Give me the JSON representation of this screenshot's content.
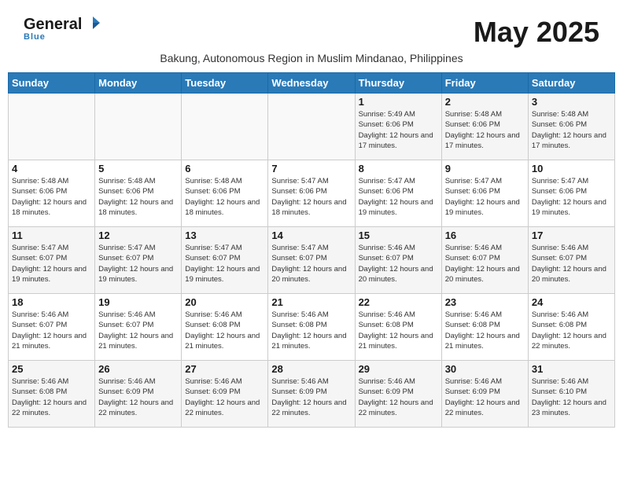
{
  "header": {
    "logo_general": "General",
    "logo_blue": "Blue",
    "month_title": "May 2025",
    "subtitle": "Bakung, Autonomous Region in Muslim Mindanao, Philippines"
  },
  "calendar": {
    "days_of_week": [
      "Sunday",
      "Monday",
      "Tuesday",
      "Wednesday",
      "Thursday",
      "Friday",
      "Saturday"
    ],
    "weeks": [
      [
        {
          "day": "",
          "info": ""
        },
        {
          "day": "",
          "info": ""
        },
        {
          "day": "",
          "info": ""
        },
        {
          "day": "",
          "info": ""
        },
        {
          "day": "1",
          "info": "Sunrise: 5:49 AM\nSunset: 6:06 PM\nDaylight: 12 hours and 17 minutes."
        },
        {
          "day": "2",
          "info": "Sunrise: 5:48 AM\nSunset: 6:06 PM\nDaylight: 12 hours and 17 minutes."
        },
        {
          "day": "3",
          "info": "Sunrise: 5:48 AM\nSunset: 6:06 PM\nDaylight: 12 hours and 17 minutes."
        }
      ],
      [
        {
          "day": "4",
          "info": "Sunrise: 5:48 AM\nSunset: 6:06 PM\nDaylight: 12 hours and 18 minutes."
        },
        {
          "day": "5",
          "info": "Sunrise: 5:48 AM\nSunset: 6:06 PM\nDaylight: 12 hours and 18 minutes."
        },
        {
          "day": "6",
          "info": "Sunrise: 5:48 AM\nSunset: 6:06 PM\nDaylight: 12 hours and 18 minutes."
        },
        {
          "day": "7",
          "info": "Sunrise: 5:47 AM\nSunset: 6:06 PM\nDaylight: 12 hours and 18 minutes."
        },
        {
          "day": "8",
          "info": "Sunrise: 5:47 AM\nSunset: 6:06 PM\nDaylight: 12 hours and 19 minutes."
        },
        {
          "day": "9",
          "info": "Sunrise: 5:47 AM\nSunset: 6:06 PM\nDaylight: 12 hours and 19 minutes."
        },
        {
          "day": "10",
          "info": "Sunrise: 5:47 AM\nSunset: 6:06 PM\nDaylight: 12 hours and 19 minutes."
        }
      ],
      [
        {
          "day": "11",
          "info": "Sunrise: 5:47 AM\nSunset: 6:07 PM\nDaylight: 12 hours and 19 minutes."
        },
        {
          "day": "12",
          "info": "Sunrise: 5:47 AM\nSunset: 6:07 PM\nDaylight: 12 hours and 19 minutes."
        },
        {
          "day": "13",
          "info": "Sunrise: 5:47 AM\nSunset: 6:07 PM\nDaylight: 12 hours and 19 minutes."
        },
        {
          "day": "14",
          "info": "Sunrise: 5:47 AM\nSunset: 6:07 PM\nDaylight: 12 hours and 20 minutes."
        },
        {
          "day": "15",
          "info": "Sunrise: 5:46 AM\nSunset: 6:07 PM\nDaylight: 12 hours and 20 minutes."
        },
        {
          "day": "16",
          "info": "Sunrise: 5:46 AM\nSunset: 6:07 PM\nDaylight: 12 hours and 20 minutes."
        },
        {
          "day": "17",
          "info": "Sunrise: 5:46 AM\nSunset: 6:07 PM\nDaylight: 12 hours and 20 minutes."
        }
      ],
      [
        {
          "day": "18",
          "info": "Sunrise: 5:46 AM\nSunset: 6:07 PM\nDaylight: 12 hours and 21 minutes."
        },
        {
          "day": "19",
          "info": "Sunrise: 5:46 AM\nSunset: 6:07 PM\nDaylight: 12 hours and 21 minutes."
        },
        {
          "day": "20",
          "info": "Sunrise: 5:46 AM\nSunset: 6:08 PM\nDaylight: 12 hours and 21 minutes."
        },
        {
          "day": "21",
          "info": "Sunrise: 5:46 AM\nSunset: 6:08 PM\nDaylight: 12 hours and 21 minutes."
        },
        {
          "day": "22",
          "info": "Sunrise: 5:46 AM\nSunset: 6:08 PM\nDaylight: 12 hours and 21 minutes."
        },
        {
          "day": "23",
          "info": "Sunrise: 5:46 AM\nSunset: 6:08 PM\nDaylight: 12 hours and 21 minutes."
        },
        {
          "day": "24",
          "info": "Sunrise: 5:46 AM\nSunset: 6:08 PM\nDaylight: 12 hours and 22 minutes."
        }
      ],
      [
        {
          "day": "25",
          "info": "Sunrise: 5:46 AM\nSunset: 6:08 PM\nDaylight: 12 hours and 22 minutes."
        },
        {
          "day": "26",
          "info": "Sunrise: 5:46 AM\nSunset: 6:09 PM\nDaylight: 12 hours and 22 minutes."
        },
        {
          "day": "27",
          "info": "Sunrise: 5:46 AM\nSunset: 6:09 PM\nDaylight: 12 hours and 22 minutes."
        },
        {
          "day": "28",
          "info": "Sunrise: 5:46 AM\nSunset: 6:09 PM\nDaylight: 12 hours and 22 minutes."
        },
        {
          "day": "29",
          "info": "Sunrise: 5:46 AM\nSunset: 6:09 PM\nDaylight: 12 hours and 22 minutes."
        },
        {
          "day": "30",
          "info": "Sunrise: 5:46 AM\nSunset: 6:09 PM\nDaylight: 12 hours and 22 minutes."
        },
        {
          "day": "31",
          "info": "Sunrise: 5:46 AM\nSunset: 6:10 PM\nDaylight: 12 hours and 23 minutes."
        }
      ]
    ]
  }
}
